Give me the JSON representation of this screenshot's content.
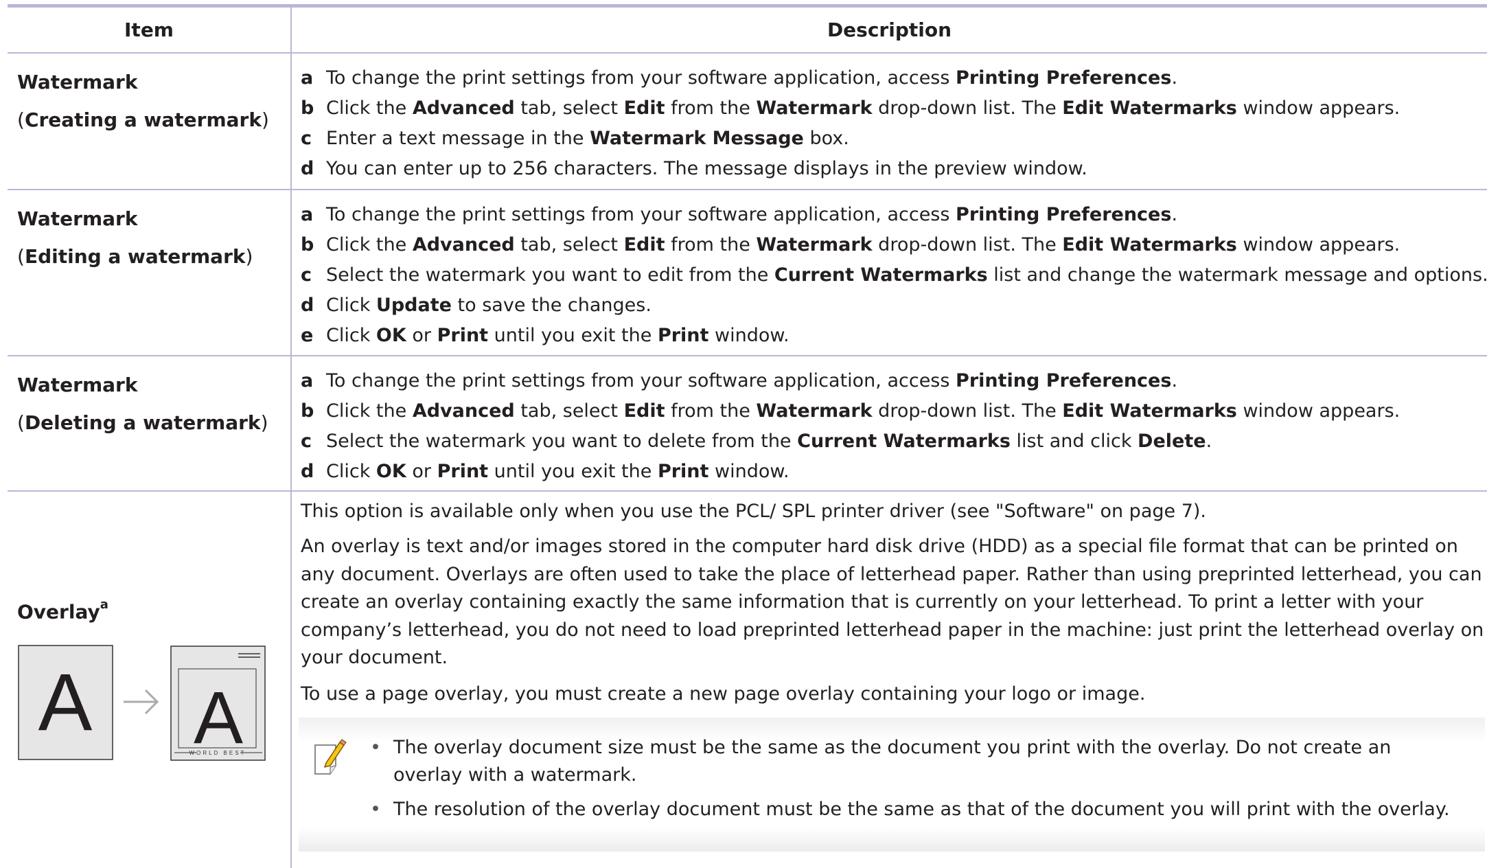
{
  "table": {
    "header_item": "Item",
    "header_description": "Description"
  },
  "rows": [
    {
      "item_title": "Watermark",
      "item_sub": "Creating a watermark",
      "steps": [
        {
          "letter": "a",
          "parts": [
            [
              "To change the print settings from your software application, access ",
              false
            ],
            [
              "Printing Preferences",
              true
            ],
            [
              ".",
              false
            ]
          ]
        },
        {
          "letter": "b",
          "parts": [
            [
              "Click the ",
              false
            ],
            [
              "Advanced",
              true
            ],
            [
              " tab, select ",
              false
            ],
            [
              "Edit",
              true
            ],
            [
              " from the ",
              false
            ],
            [
              "Watermark",
              true
            ],
            [
              " drop-down list. The ",
              false
            ],
            [
              "Edit Watermarks",
              true
            ],
            [
              " window appears.",
              false
            ]
          ]
        },
        {
          "letter": "c",
          "parts": [
            [
              "Enter a text message in the ",
              false
            ],
            [
              "Watermark Message",
              true
            ],
            [
              " box.",
              false
            ]
          ]
        },
        {
          "letter": "d",
          "parts": [
            [
              "You can enter up to 256 characters. The message displays in the preview window.",
              false
            ]
          ]
        }
      ]
    },
    {
      "item_title": "Watermark",
      "item_sub": "Editing a watermark",
      "steps": [
        {
          "letter": "a",
          "parts": [
            [
              "To change the print settings from your software application, access ",
              false
            ],
            [
              "Printing Preferences",
              true
            ],
            [
              ".",
              false
            ]
          ]
        },
        {
          "letter": "b",
          "parts": [
            [
              "Click the ",
              false
            ],
            [
              "Advanced",
              true
            ],
            [
              " tab, select ",
              false
            ],
            [
              "Edit",
              true
            ],
            [
              " from the ",
              false
            ],
            [
              "Watermark",
              true
            ],
            [
              " drop-down list. The ",
              false
            ],
            [
              "Edit Watermarks",
              true
            ],
            [
              " window appears.",
              false
            ]
          ]
        },
        {
          "letter": "c",
          "parts": [
            [
              "Select the watermark you want to edit from the ",
              false
            ],
            [
              "Current Watermarks",
              true
            ],
            [
              " list and change the watermark message and options.",
              false
            ]
          ]
        },
        {
          "letter": "d",
          "parts": [
            [
              "Click ",
              false
            ],
            [
              "Update",
              true
            ],
            [
              " to save the changes.",
              false
            ]
          ]
        },
        {
          "letter": "e",
          "parts": [
            [
              "Click ",
              false
            ],
            [
              "OK",
              true
            ],
            [
              " or ",
              false
            ],
            [
              "Print",
              true
            ],
            [
              " until you exit the ",
              false
            ],
            [
              "Print",
              true
            ],
            [
              " window.",
              false
            ]
          ]
        }
      ]
    },
    {
      "item_title": "Watermark",
      "item_sub": "Deleting a watermark",
      "steps": [
        {
          "letter": "a",
          "parts": [
            [
              "To change the print settings from your software application, access ",
              false
            ],
            [
              "Printing Preferences",
              true
            ],
            [
              ".",
              false
            ]
          ]
        },
        {
          "letter": "b",
          "parts": [
            [
              "Click the ",
              false
            ],
            [
              "Advanced",
              true
            ],
            [
              " tab, select ",
              false
            ],
            [
              "Edit",
              true
            ],
            [
              " from the ",
              false
            ],
            [
              "Watermark",
              true
            ],
            [
              " drop-down list. The ",
              false
            ],
            [
              "Edit Watermarks",
              true
            ],
            [
              " window appears.",
              false
            ]
          ]
        },
        {
          "letter": "c",
          "parts": [
            [
              "Select the watermark you want to delete from the ",
              false
            ],
            [
              "Current Watermarks",
              true
            ],
            [
              " list and click ",
              false
            ],
            [
              "Delete",
              true
            ],
            [
              ".",
              false
            ]
          ]
        },
        {
          "letter": "d",
          "parts": [
            [
              "Click ",
              false
            ],
            [
              "OK",
              true
            ],
            [
              " or ",
              false
            ],
            [
              "Print",
              true
            ],
            [
              " until you exit the ",
              false
            ],
            [
              "Print",
              true
            ],
            [
              " window.",
              false
            ]
          ]
        }
      ]
    }
  ],
  "overlay": {
    "item_title": "Overlay",
    "item_sup": "a",
    "para1": "This option is available only when you use the PCL/ SPL printer driver (see \"Software\" on page 7).",
    "para2": "An overlay is text and/or images stored in the computer hard disk drive (HDD) as a special file format that can be printed on any document. Overlays are often used to take the place of letterhead paper. Rather than using preprinted letterhead, you can create an overlay containing exactly the same information that is currently on your letterhead. To print a letter with your company’s letterhead, you do not need to load preprinted letterhead paper in the machine: just print the letterhead overlay on your document.",
    "para3": "To use a page overlay, you must create a new page overlay containing your logo or image.",
    "illustration": {
      "letter": "A",
      "footer_text": "WORLD BEST"
    },
    "notes": [
      "The overlay document size must be the same as the document you print with the overlay. Do not create an overlay with a watermark.",
      "The resolution of the overlay document must be the same as that of the document you will print with the overlay."
    ]
  }
}
